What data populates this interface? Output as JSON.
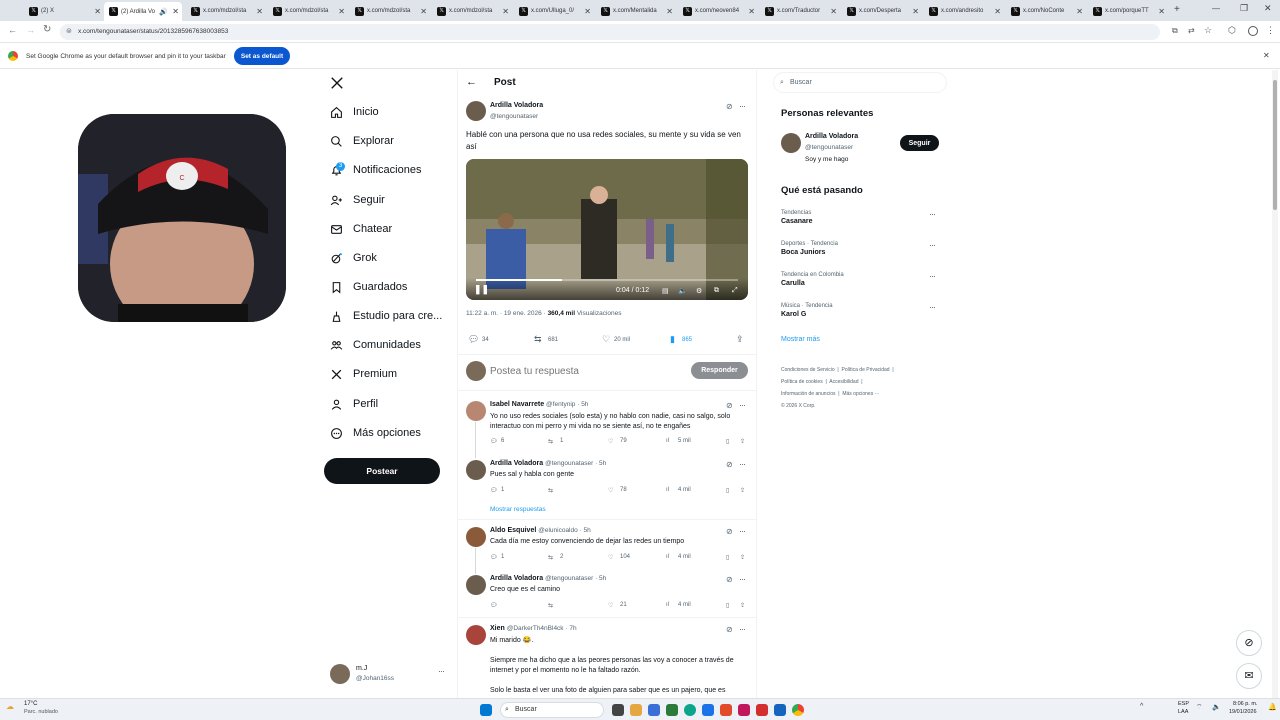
{
  "browser": {
    "tabs": [
      {
        "label": "(2) X"
      },
      {
        "label": "(2) Ardilla Vo"
      },
      {
        "label": "x.com/mdzol/sta"
      },
      {
        "label": "x.com/mdzol/sta"
      },
      {
        "label": "x.com/mdzol/sta"
      },
      {
        "label": "x.com/mdzol/sta"
      },
      {
        "label": "x.com/Ulluga_0/"
      },
      {
        "label": "x.com/Mentalida"
      },
      {
        "label": "x.com/neoven84"
      },
      {
        "label": "x.com/Traductor"
      },
      {
        "label": "x.com/Desperta"
      },
      {
        "label": "x.com/andresito"
      },
      {
        "label": "x.com/NoConte"
      },
      {
        "label": "x.com/porqueTT"
      }
    ],
    "url": "x.com/tengounataser/status/2013285967638003853",
    "infobar_text": "Set Google Chrome as your default browser and pin it to your taskbar",
    "set_default_label": "Set as default"
  },
  "sidebar": {
    "items": [
      {
        "label": "Inicio",
        "icon": "home-icon"
      },
      {
        "label": "Explorar",
        "icon": "search-icon"
      },
      {
        "label": "Notificaciones",
        "icon": "bell-icon",
        "badge": "3"
      },
      {
        "label": "Seguir",
        "icon": "follow-icon"
      },
      {
        "label": "Chatear",
        "icon": "mail-icon"
      },
      {
        "label": "Grok",
        "icon": "grok-icon"
      },
      {
        "label": "Guardados",
        "icon": "bookmark-icon"
      },
      {
        "label": "Estudio para cre...",
        "icon": "studio-icon"
      },
      {
        "label": "Comunidades",
        "icon": "communities-icon"
      },
      {
        "label": "Premium",
        "icon": "x-logo-icon"
      },
      {
        "label": "Perfil",
        "icon": "profile-icon"
      },
      {
        "label": "Más opciones",
        "icon": "more-icon"
      }
    ],
    "post_label": "Postear",
    "account": {
      "name": "m.J",
      "handle": "@Johan16ss"
    }
  },
  "post": {
    "header_title": "Post",
    "author": "Ardilla Voladora",
    "handle": "@tengounataser",
    "text": "Hablé con una persona que no usa redes sociales, su mente y su vida se ven así",
    "video_time": "0:04 / 0:12",
    "video_progress": 0.33,
    "timestamp": "11:22 a. m. · 19 ene. 2026 ·",
    "views": "360,4 mil",
    "views_label": "Visualizaciones",
    "replies": "34",
    "reposts": "681",
    "likes": "20 mil",
    "bookmarks": "865",
    "reply_placeholder": "Postea tu respuesta",
    "reply_button": "Responder"
  },
  "replies": [
    {
      "name": "Isabel Navarrete",
      "handle": "@fentynip · 5h",
      "text": "Yo no uso redes sociales (solo esta) y no hablo con nadie, casi no salgo, solo interactuo con mi perro y mi vida no se siente así, no te engañes",
      "replies": "6",
      "reposts": "1",
      "likes": "79",
      "views": "5 mil"
    },
    {
      "name": "Ardilla Voladora",
      "handle": "@tengounataser · 5h",
      "text": "Pues sal y habla con gente",
      "replies": "1",
      "reposts": "",
      "likes": "78",
      "views": "4 mil",
      "show_replies": "Mostrar respuestas"
    },
    {
      "name": "Aldo Esquivel",
      "handle": "@elunicoaldo · 5h",
      "text": "Cada día me estoy convenciendo de dejar las redes un tiempo",
      "replies": "1",
      "reposts": "2",
      "likes": "104",
      "views": "4 mil"
    },
    {
      "name": "Ardilla Voladora",
      "handle": "@tengounataser · 5h",
      "text": "Creo que es el camino",
      "replies": "",
      "reposts": "",
      "likes": "21",
      "views": "4 mil"
    },
    {
      "name": "Xien",
      "handle": "@DarkerTh4nBl4ck · 7h",
      "text": "Mi marido 😂.",
      "text2": "Siempre me ha dicho que a las peores personas las voy a conocer a través de internet y por el momento no le ha faltado razón.",
      "text3": "Solo le basta el ver una foto de alguien para saber que es un pajero, que es"
    }
  ],
  "right": {
    "search_placeholder": "Buscar",
    "relevant_title": "Personas relevantes",
    "relevant": {
      "name": "Ardilla Voladora",
      "handle": "@tengounataser",
      "bio": "Soy y me hago",
      "follow_label": "Seguir"
    },
    "trends_title": "Qué está pasando",
    "trends": [
      {
        "category": "Tendencias",
        "title": "Casanare"
      },
      {
        "category": "Deportes · Tendencia",
        "title": "Boca Juniors"
      },
      {
        "category": "Tendencia en Colombia",
        "title": "Carulla"
      },
      {
        "category": "Música · Tendencia",
        "title": "Karol G"
      }
    ],
    "show_more": "Mostrar más",
    "footer": [
      "Condiciones de Servicio",
      "Política de Privacidad",
      "Política de cookies",
      "Accesibilidad",
      "Información de anuncios",
      "Más opciones ···",
      "© 2026 X Corp."
    ]
  },
  "taskbar": {
    "weather_temp": "17°C",
    "weather_desc": "Parc. nublado",
    "search_label": "Buscar",
    "lang": "ESP",
    "lang2": "LAA",
    "time": "8:06 p. m.",
    "date": "19/01/2026"
  }
}
